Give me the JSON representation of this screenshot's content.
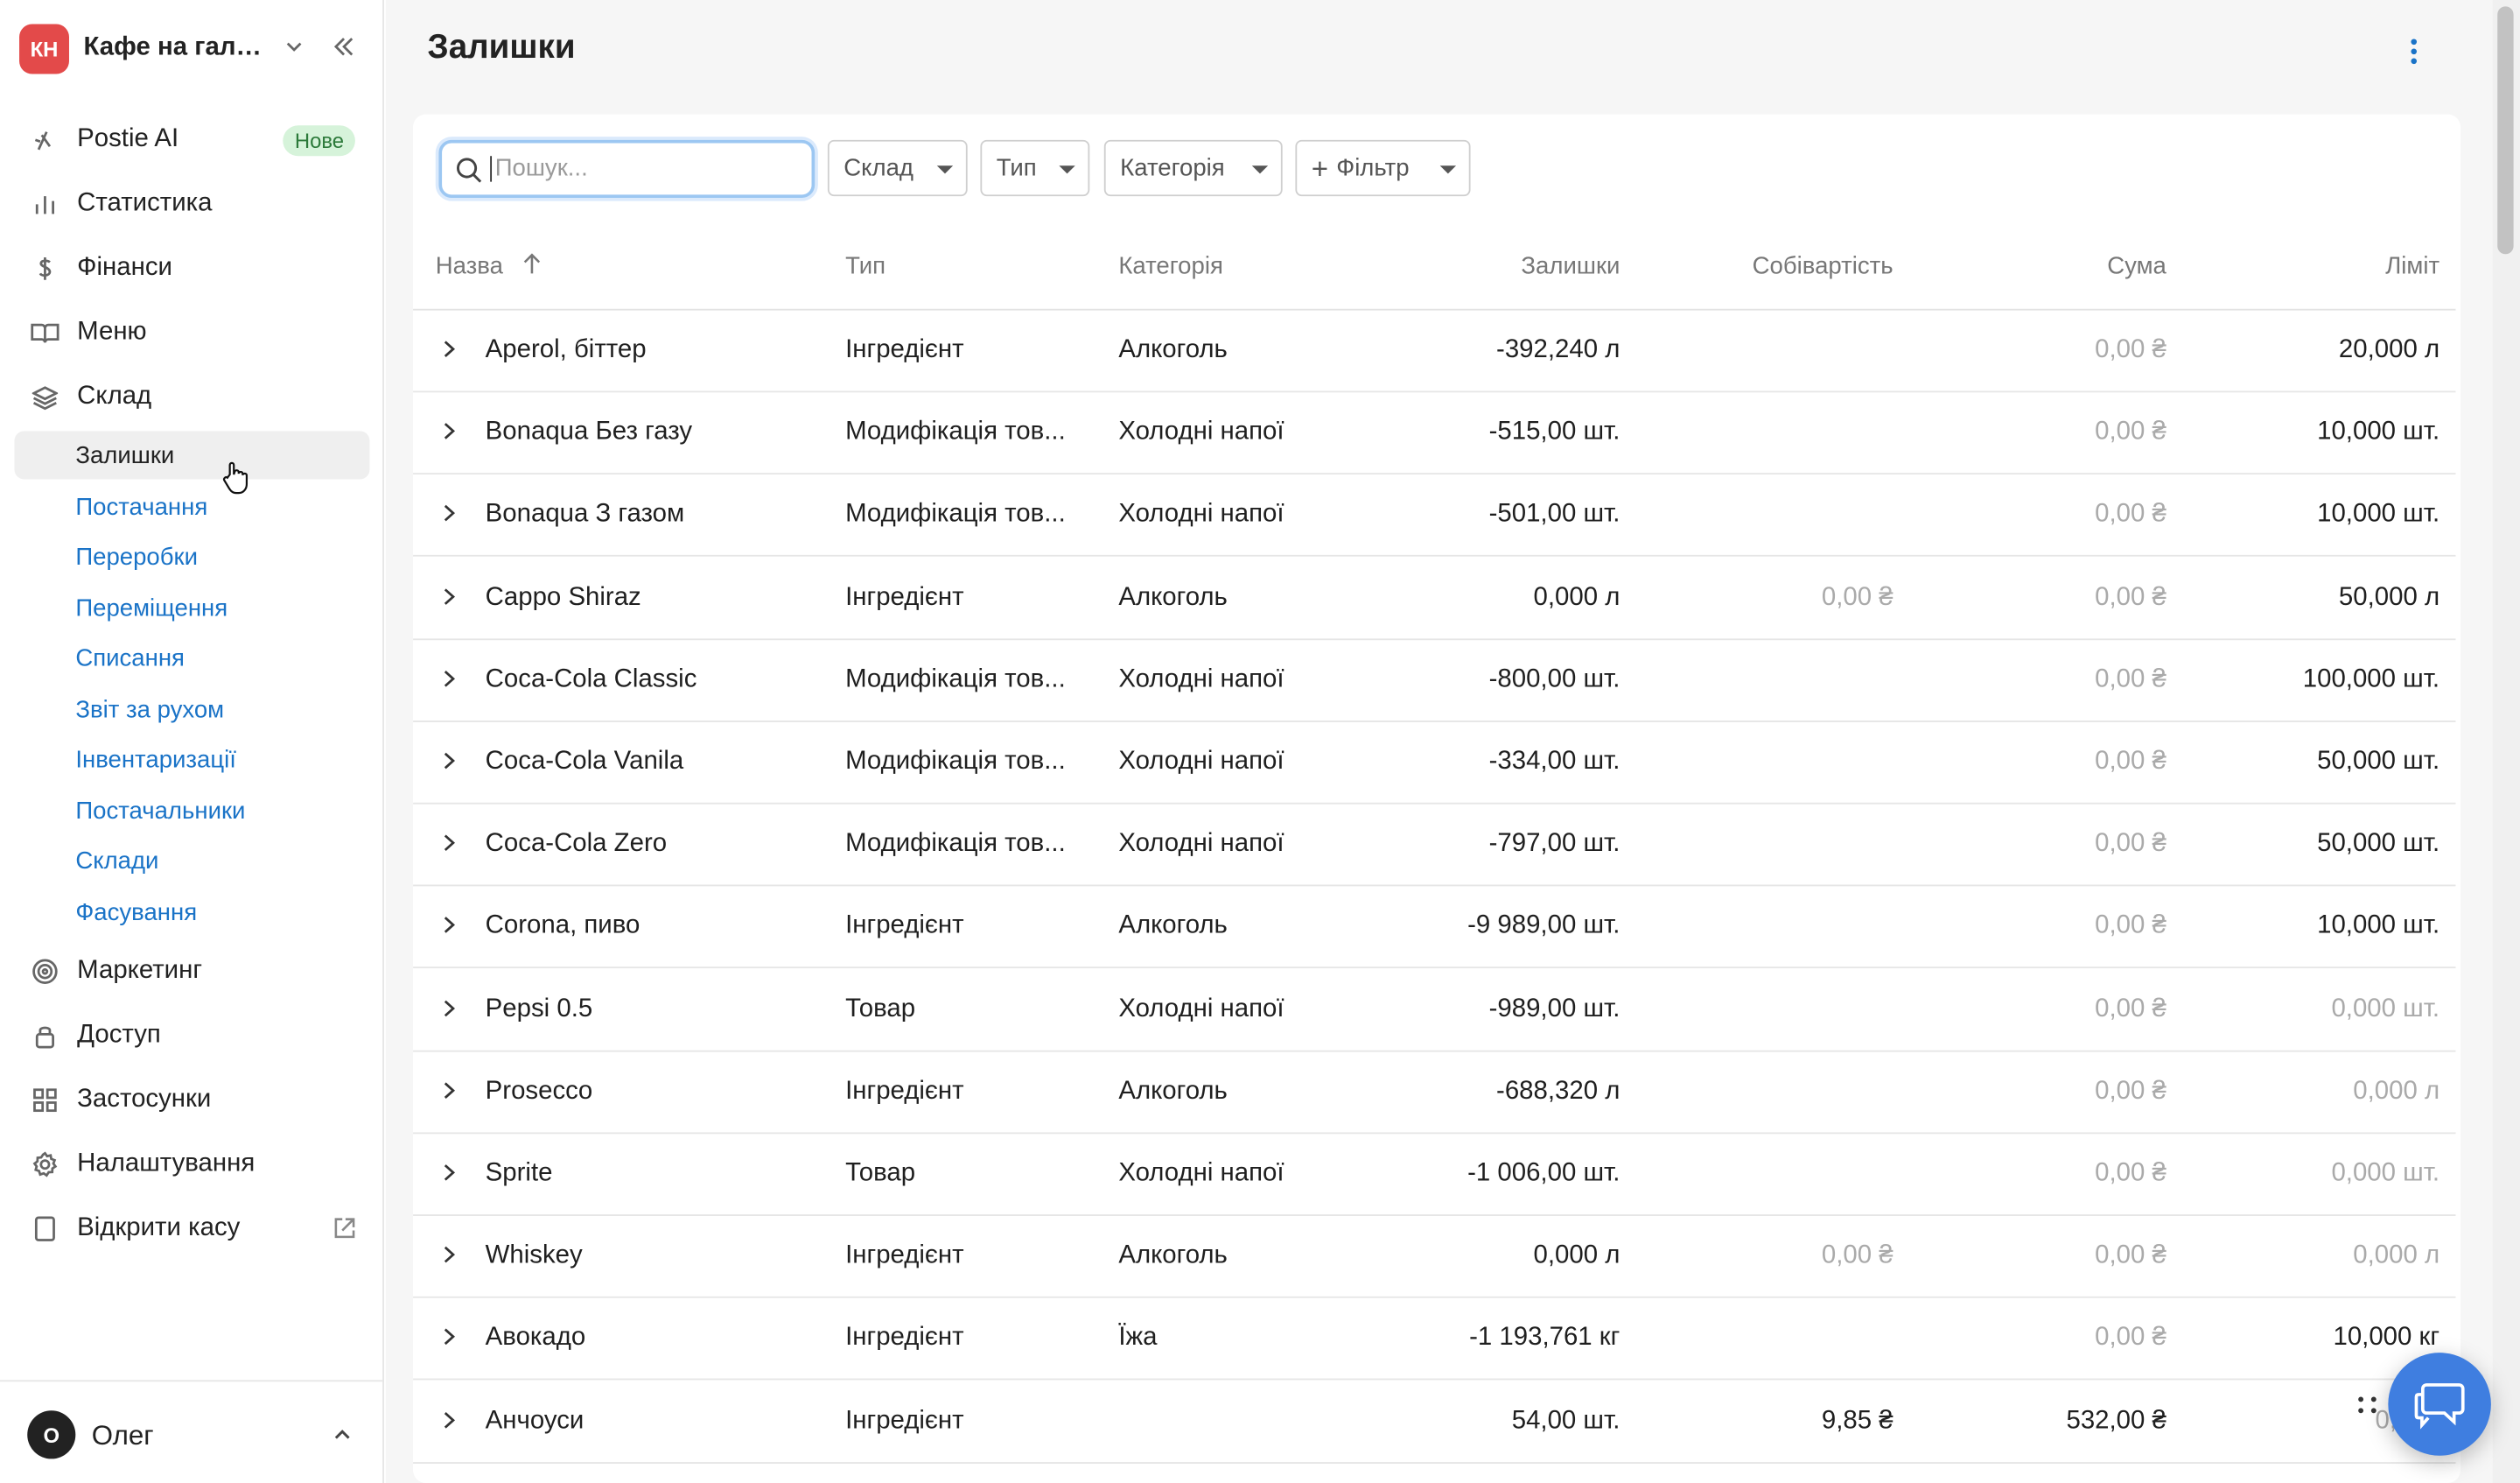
{
  "sidebar": {
    "brand": {
      "initials": "КН",
      "name": "Кафе на галя..."
    },
    "nav": [
      {
        "label": "Postie AI",
        "icon": "sparkle-icon",
        "badge": "Нове"
      },
      {
        "label": "Статистика",
        "icon": "bar-chart-icon"
      },
      {
        "label": "Фінанси",
        "icon": "dollar-icon"
      },
      {
        "label": "Меню",
        "icon": "book-icon"
      },
      {
        "label": "Склад",
        "icon": "layers-icon"
      }
    ],
    "warehouse_sub": [
      "Залишки",
      "Постачання",
      "Переробки",
      "Переміщення",
      "Списання",
      "Звіт за рухом",
      "Інвентаризації",
      "Постачальники",
      "Склади",
      "Фасування"
    ],
    "nav_bottom": [
      {
        "label": "Маркетинг",
        "icon": "target-icon"
      },
      {
        "label": "Доступ",
        "icon": "lock-icon"
      },
      {
        "label": "Застосунки",
        "icon": "apps-grid-icon"
      },
      {
        "label": "Налаштування",
        "icon": "gear-icon"
      },
      {
        "label": "Відкрити касу",
        "icon": "tablet-icon"
      }
    ],
    "user": {
      "initial": "О",
      "name": "Олег"
    }
  },
  "main": {
    "title": "Залишки",
    "search": {
      "placeholder": "Пошук..."
    },
    "filters": [
      "Склад",
      "Тип",
      "Категорія",
      "Фільтр"
    ],
    "columns": [
      "Назва",
      "Тип",
      "Категорія",
      "Залишки",
      "Собівартість",
      "Сума",
      "Ліміт"
    ],
    "rows": [
      {
        "name": "Aperol, біттер",
        "type": "Інгредієнт",
        "category": "Алкоголь",
        "stock": "-392,240 л",
        "cost": "",
        "sum": "0,00 ₴",
        "limit": "20,000 л",
        "limit_muted": false,
        "sum_muted": true
      },
      {
        "name": "Bonaqua Без газу",
        "type": "Модифікація тов...",
        "category": "Холодні напої",
        "stock": "-515,00 шт.",
        "cost": "",
        "sum": "0,00 ₴",
        "limit": "10,000 шт.",
        "limit_muted": false,
        "sum_muted": true
      },
      {
        "name": "Bonaqua З газом",
        "type": "Модифікація тов...",
        "category": "Холодні напої",
        "stock": "-501,00 шт.",
        "cost": "",
        "sum": "0,00 ₴",
        "limit": "10,000 шт.",
        "limit_muted": false,
        "sum_muted": true
      },
      {
        "name": "Cappo Shiraz",
        "type": "Інгредієнт",
        "category": "Алкоголь",
        "stock": "0,000 л",
        "cost": "0,00 ₴",
        "sum": "0,00 ₴",
        "limit": "50,000 л",
        "limit_muted": false,
        "sum_muted": true
      },
      {
        "name": "Coca-Cola Classic",
        "type": "Модифікація тов...",
        "category": "Холодні напої",
        "stock": "-800,00 шт.",
        "cost": "",
        "sum": "0,00 ₴",
        "limit": "100,000 шт.",
        "limit_muted": false,
        "sum_muted": true
      },
      {
        "name": "Coca-Cola Vanila",
        "type": "Модифікація тов...",
        "category": "Холодні напої",
        "stock": "-334,00 шт.",
        "cost": "",
        "sum": "0,00 ₴",
        "limit": "50,000 шт.",
        "limit_muted": false,
        "sum_muted": true
      },
      {
        "name": "Coca-Cola Zero",
        "type": "Модифікація тов...",
        "category": "Холодні напої",
        "stock": "-797,00 шт.",
        "cost": "",
        "sum": "0,00 ₴",
        "limit": "50,000 шт.",
        "limit_muted": false,
        "sum_muted": true
      },
      {
        "name": "Corona, пиво",
        "type": "Інгредієнт",
        "category": "Алкоголь",
        "stock": "-9 989,00 шт.",
        "cost": "",
        "sum": "0,00 ₴",
        "limit": "10,000 шт.",
        "limit_muted": false,
        "sum_muted": true
      },
      {
        "name": "Pepsi 0.5",
        "type": "Товар",
        "category": "Холодні напої",
        "stock": "-989,00 шт.",
        "cost": "",
        "sum": "0,00 ₴",
        "limit": "0,000 шт.",
        "limit_muted": true,
        "sum_muted": true
      },
      {
        "name": "Prosecco",
        "type": "Інгредієнт",
        "category": "Алкоголь",
        "stock": "-688,320 л",
        "cost": "",
        "sum": "0,00 ₴",
        "limit": "0,000 л",
        "limit_muted": true,
        "sum_muted": true
      },
      {
        "name": "Sprite",
        "type": "Товар",
        "category": "Холодні напої",
        "stock": "-1 006,00 шт.",
        "cost": "",
        "sum": "0,00 ₴",
        "limit": "0,000 шт.",
        "limit_muted": true,
        "sum_muted": true
      },
      {
        "name": "Whiskey",
        "type": "Інгредієнт",
        "category": "Алкоголь",
        "stock": "0,000 л",
        "cost": "0,00 ₴",
        "sum": "0,00 ₴",
        "limit": "0,000 л",
        "limit_muted": true,
        "sum_muted": true
      },
      {
        "name": "Авокадо",
        "type": "Інгредієнт",
        "category": "Їжа",
        "stock": "-1 193,761 кг",
        "cost": "",
        "sum": "0,00 ₴",
        "limit": "10,000 кг",
        "limit_muted": false,
        "sum_muted": true
      },
      {
        "name": "Анчоуси",
        "type": "Інгредієнт",
        "category": "",
        "stock": "54,00 шт.",
        "cost": "9,85 ₴",
        "sum": "532,00 ₴",
        "limit": "0,000",
        "limit_muted": true,
        "sum_muted": false
      }
    ]
  },
  "colors": {
    "accent": "#1a73c7",
    "brand": "#e34a4a",
    "chat": "#3f7ee0",
    "badge_bg": "#d6f3da"
  }
}
